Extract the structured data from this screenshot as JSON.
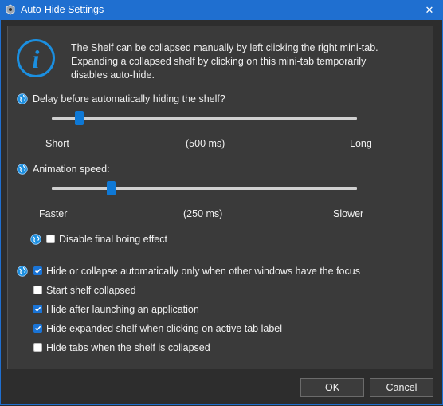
{
  "window": {
    "title": "Auto-Hide Settings",
    "close_glyph": "✕"
  },
  "info": {
    "icon_letter": "i",
    "lines": [
      "The Shelf can be collapsed manually by left clicking the right mini-tab.",
      "Expanding a collapsed shelf by clicking on this mini-tab temporarily",
      "disables auto-hide."
    ]
  },
  "delay": {
    "label": "Delay before automatically hiding the shelf?",
    "min_label": "Short",
    "value_label": "(500 ms)",
    "max_label": "Long",
    "position_fraction": 0.09
  },
  "animation": {
    "label": "Animation speed:",
    "min_label": "Faster",
    "value_label": "(250 ms)",
    "max_label": "Slower",
    "position_fraction": 0.195
  },
  "options": {
    "disable_boing": {
      "label": "Disable final boing effect",
      "checked": false
    },
    "hide_only_other_focus": {
      "label": "Hide or collapse automatically only when other windows have the focus",
      "checked": true
    },
    "start_collapsed": {
      "label": "Start shelf collapsed",
      "checked": false
    },
    "hide_after_launch": {
      "label": "Hide after launching an application",
      "checked": true
    },
    "hide_expanded_on_tab": {
      "label": "Hide expanded shelf when clicking on active tab label",
      "checked": true
    },
    "hide_tabs_collapsed": {
      "label": "Hide tabs when the shelf is collapsed",
      "checked": false
    }
  },
  "buttons": {
    "ok": "OK",
    "cancel": "Cancel"
  },
  "colors": {
    "accent": "#1f6fd0",
    "info_icon": "#1b8fe0",
    "slider_thumb": "#0e78d5"
  }
}
